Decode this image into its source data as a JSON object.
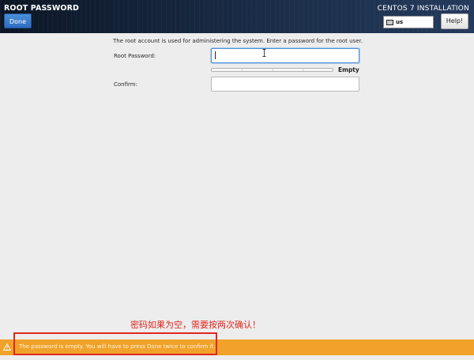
{
  "header": {
    "page_title": "ROOT PASSWORD",
    "install_title": "CENTOS 7 INSTALLATION",
    "done_label": "Done",
    "help_label": "Help!",
    "keyboard_layout": "us"
  },
  "form": {
    "description": "The root account is used for administering the system.  Enter a password for the root user.",
    "root_password_label": "Root Password:",
    "root_password_value": "",
    "confirm_label": "Confirm:",
    "confirm_value": "",
    "strength_label": "Empty",
    "strength_fraction": 0
  },
  "annotation": {
    "text": "密码如果为空，需要按两次确认！"
  },
  "warning": {
    "text": "The password is empty. You will have to press Done twice to confirm it."
  },
  "colors": {
    "accent": "#4a90d9",
    "warning_bar": "#f0a22a",
    "annotation": "#e0281e"
  }
}
